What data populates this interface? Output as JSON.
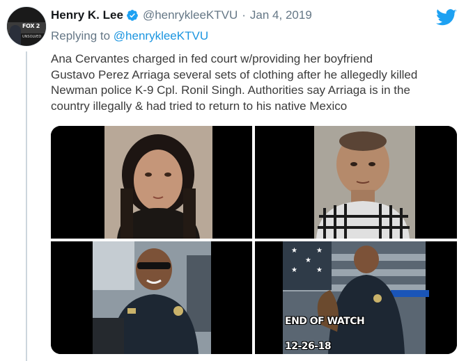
{
  "tweet": {
    "author": {
      "name": "Henry K. Lee",
      "handle": "@henrykleeKTVU",
      "avatar_logo_text": "FOX 2",
      "avatar_sub_text": "UNSOLVED",
      "verified_icon": "verified-badge-icon"
    },
    "separator": "·",
    "date": "Jan 4, 2019",
    "reply": {
      "prefix": "Replying to",
      "mention": "@henrykleeKTVU"
    },
    "text_lines": [
      "Ana Cervantes charged in fed court w/providing her boyfriend",
      "Gustavo Perez Arriaga several sets of clothing after he allegedly killed",
      "Newman police K-9 Cpl. Ronil Singh. Authorities say Arriaga is in the",
      "country illegally & had tried to return to his native Mexico"
    ],
    "media": {
      "count": 4,
      "overlay_title": "END OF WATCH",
      "overlay_date": "12-26-18"
    }
  },
  "icons": {
    "brand": "twitter-bird-icon",
    "verified": "verified-badge-icon"
  },
  "colors": {
    "text": "#14171a",
    "secondary": "#657786",
    "link": "#1b95e0",
    "brand": "#1da1f2"
  }
}
